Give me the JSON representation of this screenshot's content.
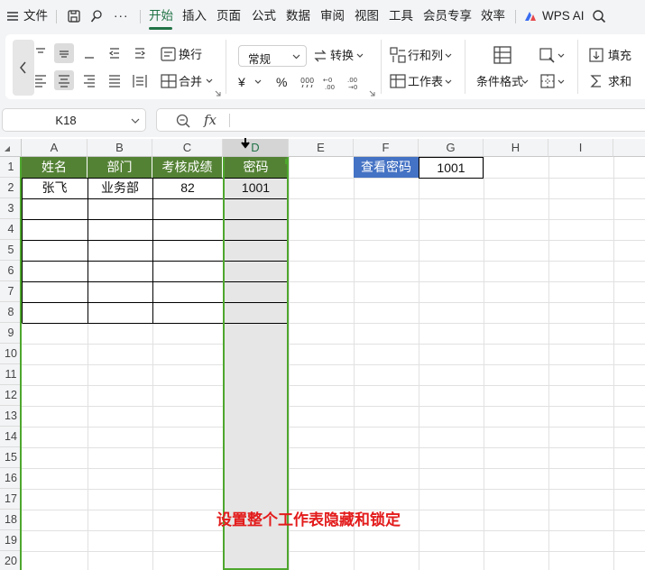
{
  "menu": {
    "file": "文件",
    "more": "···",
    "tabs": [
      "开始",
      "插入",
      "页面",
      "公式",
      "数据",
      "审阅",
      "视图",
      "工具",
      "会员专享",
      "效率"
    ],
    "active_tab": "开始",
    "wps_ai": "WPS AI"
  },
  "ribbon": {
    "wrap": "换行",
    "merge": "合并",
    "format_select": "常规",
    "convert": "转换",
    "rows_cols": "行和列",
    "worksheet": "工作表",
    "cond_format": "条件格式",
    "fill": "填充",
    "sum": "求和",
    "currency": "¥",
    "percent": "%"
  },
  "formula_bar": {
    "cell_ref": "K18",
    "fx": "fx",
    "content": ""
  },
  "grid": {
    "columns": [
      "A",
      "B",
      "C",
      "D",
      "E",
      "F",
      "G",
      "H",
      "I"
    ],
    "selected_column": "D",
    "rows": [
      "1",
      "2",
      "3",
      "4",
      "5",
      "6",
      "7",
      "8",
      "9",
      "10",
      "11",
      "12",
      "13",
      "14",
      "15",
      "16",
      "17",
      "18",
      "19",
      "20"
    ],
    "table_header": [
      "姓名",
      "部门",
      "考核成绩",
      "密码"
    ],
    "table_row": [
      "张飞",
      "业务部",
      "82",
      "1001"
    ],
    "lookup_label": "查看密码",
    "lookup_value": "1001"
  },
  "annotation": "设置整个工作表隐藏和锁定",
  "colors": {
    "accent_green": "#217346",
    "header_green": "#548235",
    "button_blue": "#4472c4",
    "note_red": "#e31b1b"
  }
}
